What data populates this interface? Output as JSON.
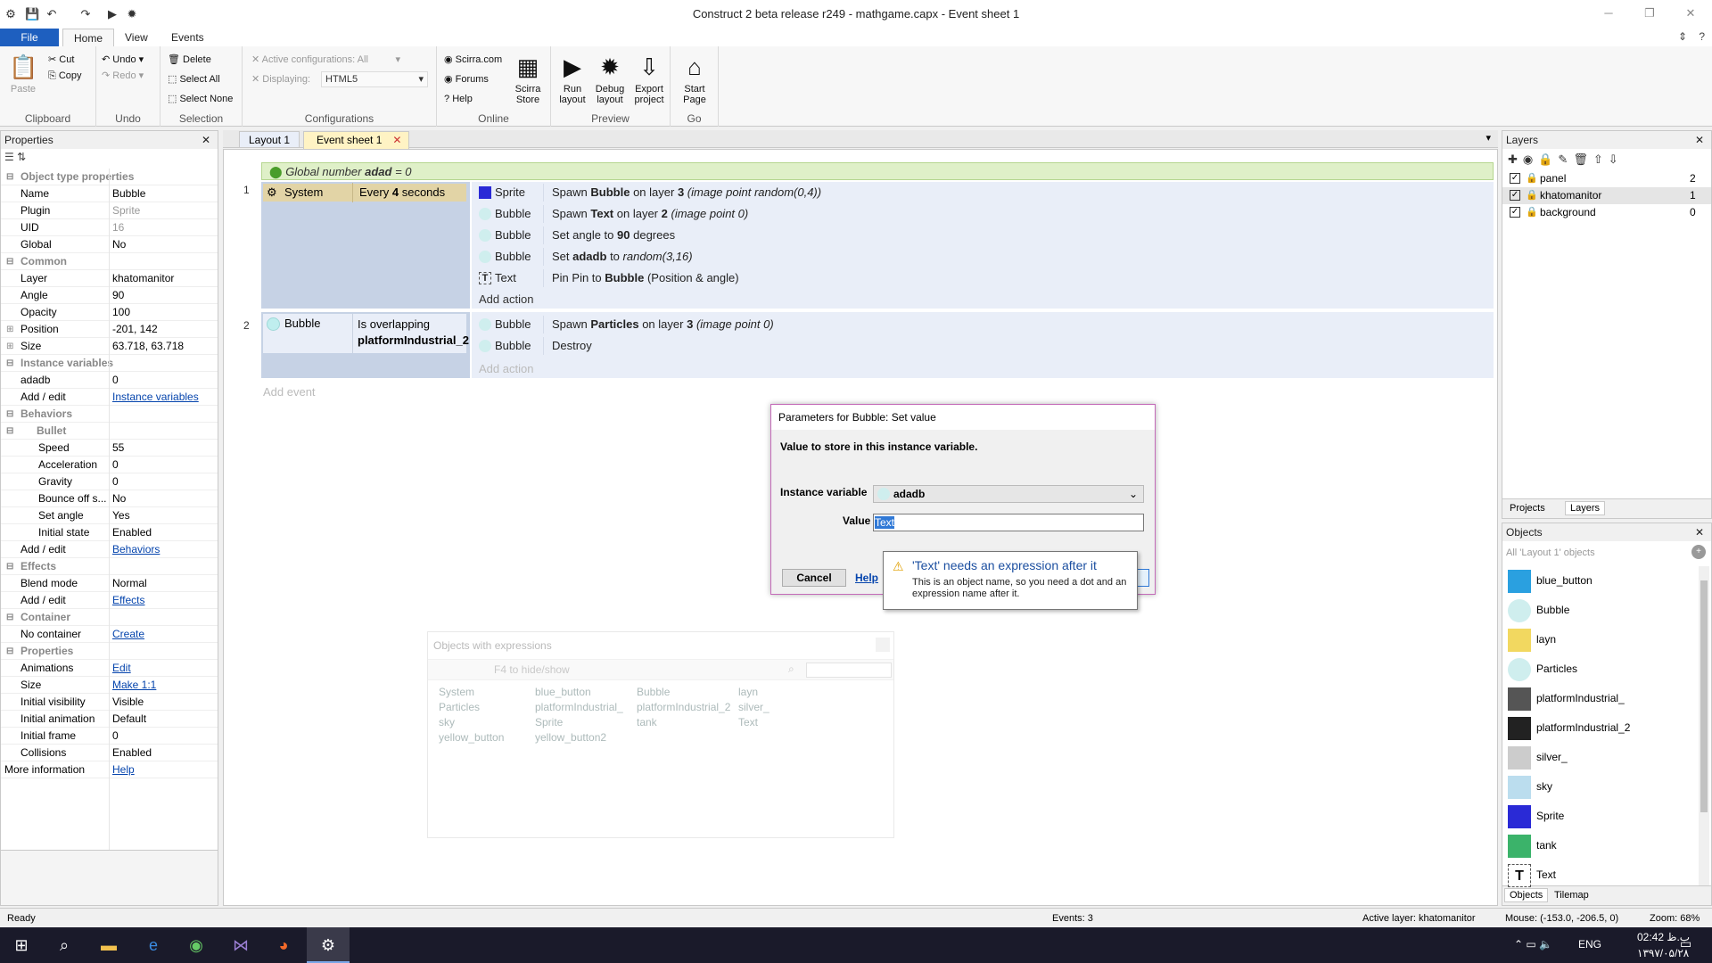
{
  "window": {
    "title": "Construct 2 beta release r249 - mathgame.capx - Event sheet 1"
  },
  "ribbon_tabs": [
    "File",
    "Home",
    "View",
    "Events"
  ],
  "ribbon": {
    "clipboard": {
      "paste": "Paste",
      "cut": "Cut",
      "copy": "Copy",
      "label": "Clipboard"
    },
    "undo": {
      "undo": "Undo",
      "redo": "Redo",
      "label": "Undo"
    },
    "selection": {
      "delete": "Delete",
      "select_all": "Select All",
      "select_none": "Select None",
      "label": "Selection"
    },
    "configurations": {
      "active": "Active configurations: All",
      "displaying": "Displaying:",
      "displaying_value": "HTML5",
      "label": "Configurations"
    },
    "online": {
      "scirra": "Scirra.com",
      "forums": "Forums",
      "help": "Help",
      "store": "Scirra Store",
      "label": "Online"
    },
    "preview": {
      "run": "Run layout",
      "debug": "Debug layout",
      "export": "Export project",
      "label": "Preview"
    },
    "go": {
      "start": "Start Page",
      "label": "Go"
    }
  },
  "properties": {
    "title": "Properties",
    "rows": [
      {
        "t": "cat",
        "k": "Object type properties"
      },
      {
        "k": "Name",
        "v": "Bubble"
      },
      {
        "k": "Plugin",
        "v": "Sprite",
        "dim": true
      },
      {
        "k": "UID",
        "v": "16",
        "dim": true
      },
      {
        "k": "Global",
        "v": "No"
      },
      {
        "t": "cat",
        "k": "Common"
      },
      {
        "k": "Layer",
        "v": "khatomanitor"
      },
      {
        "k": "Angle",
        "v": "90"
      },
      {
        "k": "Opacity",
        "v": "100"
      },
      {
        "k": "Position",
        "v": "-201, 142",
        "exp": "+"
      },
      {
        "k": "Size",
        "v": "63.718, 63.718",
        "exp": "+"
      },
      {
        "t": "cat",
        "k": "Instance variables"
      },
      {
        "k": "adadb",
        "v": "0"
      },
      {
        "k": "Add / edit",
        "v": "Instance variables",
        "link": true
      },
      {
        "t": "cat",
        "k": "Behaviors"
      },
      {
        "t": "cat2",
        "k": "Bullet"
      },
      {
        "k": "Speed",
        "v": "55",
        "ind": true
      },
      {
        "k": "Acceleration",
        "v": "0",
        "ind": true
      },
      {
        "k": "Gravity",
        "v": "0",
        "ind": true
      },
      {
        "k": "Bounce off s...",
        "v": "No",
        "ind": true
      },
      {
        "k": "Set angle",
        "v": "Yes",
        "ind": true
      },
      {
        "k": "Initial state",
        "v": "Enabled",
        "ind": true
      },
      {
        "k": "Add / edit",
        "v": "Behaviors",
        "link": true
      },
      {
        "t": "cat",
        "k": "Effects"
      },
      {
        "k": "Blend mode",
        "v": "Normal"
      },
      {
        "k": "Add / edit",
        "v": "Effects",
        "link": true
      },
      {
        "t": "cat",
        "k": "Container"
      },
      {
        "k": "No container",
        "v": "Create",
        "link": true
      },
      {
        "t": "cat",
        "k": "Properties"
      },
      {
        "k": "Animations",
        "v": "Edit",
        "link": true
      },
      {
        "k": "Size",
        "v": "Make 1:1",
        "link": true
      },
      {
        "k": "Initial visibility",
        "v": "Visible"
      },
      {
        "k": "Initial animation",
        "v": "Default"
      },
      {
        "k": "Initial frame",
        "v": "0"
      },
      {
        "k": "Collisions",
        "v": "Enabled"
      },
      {
        "k": "More information",
        "v": "Help",
        "link": true,
        "noind": true
      }
    ]
  },
  "doc_tabs": [
    "Layout 1",
    "Event sheet 1"
  ],
  "events": {
    "global": "Global number",
    "global_name": "adad",
    "global_rest": "= 0",
    "e1": {
      "num": "1",
      "obj": "System",
      "cond_pre": "Every",
      "cond_num": "4",
      "cond_post": "seconds",
      "actions": [
        {
          "obj": "Sprite",
          "verb": "Spawn",
          "a": "Bubble",
          "b": "on layer",
          "c": "3",
          "d": "(image point random(0,4))"
        },
        {
          "obj": "Bubble",
          "verb": "Spawn",
          "a": "Text",
          "b": "on layer",
          "c": "2",
          "d": "(image point 0)"
        },
        {
          "obj": "Bubble",
          "verb": "Set angle to",
          "a": "90",
          "b": "degrees",
          "c": "",
          "d": ""
        },
        {
          "obj": "Bubble",
          "verb": "Set",
          "a": "adadb",
          "b": "to",
          "c": "",
          "d": "random(3,16)"
        },
        {
          "obj": "Text",
          "verb": "Pin Pin to",
          "a": "Bubble",
          "b": "(Position & angle)",
          "c": "",
          "d": ""
        }
      ],
      "add_action": "Add action"
    },
    "e2": {
      "num": "2",
      "obj": "Bubble",
      "cond": "Is overlapping",
      "cond_obj": "platformIndustrial_2",
      "actions": [
        {
          "obj": "Bubble",
          "verb": "Spawn",
          "a": "Particles",
          "b": "on layer",
          "c": "3",
          "d": "(image point 0)"
        },
        {
          "obj": "Bubble",
          "verb": "Destroy",
          "a": "",
          "b": "",
          "c": "",
          "d": ""
        }
      ],
      "add_action": "Add action"
    },
    "add_event": "Add event"
  },
  "dialog": {
    "title": "Parameters for Bubble: Set value",
    "desc": "Value to store in this instance variable.",
    "var_label": "Instance variable",
    "var_value": "adadb",
    "value_label": "Value",
    "value_text": "Text",
    "cancel": "Cancel",
    "help": "Help",
    "tooltip_title": "'Text' needs an expression after it",
    "tooltip_body": "This is an object name, so you need a dot and an expression name after it."
  },
  "expr_panel": {
    "title": "Objects with expressions",
    "hint": "F4 to hide/show",
    "items": [
      "System",
      "blue_button",
      "Bubble",
      "layn",
      "Particles",
      "platformIndustrial_",
      "platformIndustrial_2",
      "silver_",
      "sky",
      "Sprite",
      "tank",
      "Text",
      "yellow_button",
      "yellow_button2"
    ]
  },
  "layers": {
    "title": "Layers",
    "rows": [
      {
        "name": "panel",
        "n": "2"
      },
      {
        "name": "khatomanitor",
        "n": "1"
      },
      {
        "name": "background",
        "n": "0"
      }
    ],
    "tabs": [
      "Projects",
      "Layers"
    ]
  },
  "objects": {
    "title": "Objects",
    "filter": "All 'Layout 1' objects",
    "items": [
      "blue_button",
      "Bubble",
      "layn",
      "Particles",
      "platformIndustrial_",
      "platformIndustrial_2",
      "silver_",
      "sky",
      "Sprite",
      "tank",
      "Text"
    ],
    "tabs": [
      "Objects",
      "Tilemap"
    ]
  },
  "status": {
    "ready": "Ready",
    "events": "Events: 3",
    "layer": "Active layer: khatomanitor",
    "mouse": "Mouse: (-153.0, -206.5, 0)",
    "zoom": "Zoom: 68%"
  },
  "taskbar": {
    "time": "02:42 ب.ظ",
    "date": "۱۳۹۷/۰۵/۲۸",
    "lang": "ENG"
  }
}
